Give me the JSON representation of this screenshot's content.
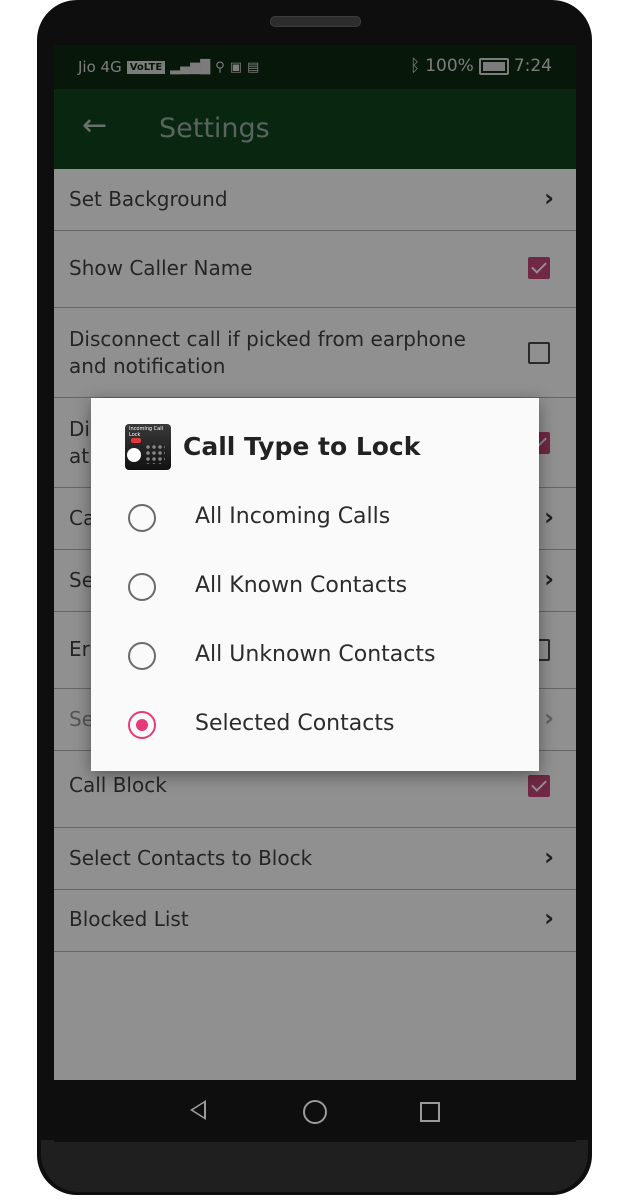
{
  "status_bar": {
    "carrier": "Jio 4G",
    "volte": "VoLTE",
    "battery": "100%",
    "time": "7:24"
  },
  "app_bar": {
    "title": "Settings",
    "back_icon": "back-arrow-icon"
  },
  "settings": [
    {
      "label": "Set Background",
      "control": "chevron"
    },
    {
      "label": "Show Caller Name",
      "control": "checkbox",
      "checked": true
    },
    {
      "label": "Disconnect call if picked from earphone and notification",
      "control": "checkbox",
      "checked": false
    },
    {
      "label": "Di",
      "label2": "at",
      "control": "checkbox",
      "checked": true
    },
    {
      "label": "Ca",
      "control": "chevron"
    },
    {
      "label": "Se",
      "control": "chevron"
    },
    {
      "label": "Er",
      "control": "checkbox",
      "checked": false
    },
    {
      "label": "Se",
      "control": "chevron",
      "disabled": true
    },
    {
      "label": "Call Block",
      "control": "checkbox",
      "checked": true
    },
    {
      "label": "Select Contacts to Block",
      "control": "chevron"
    },
    {
      "label": "Blocked List",
      "control": "chevron"
    }
  ],
  "dialog": {
    "title": "Call Type to Lock",
    "icon_text": "Incoming Call Lock",
    "options": [
      {
        "label": "All Incoming Calls",
        "selected": false
      },
      {
        "label": "All Known Contacts",
        "selected": false
      },
      {
        "label": "All Unknown Contacts",
        "selected": false
      },
      {
        "label": "Selected Contacts",
        "selected": true
      }
    ]
  },
  "colors": {
    "status_bar": "#0c2713",
    "app_bar": "#0f3e1c",
    "accent": "#e8397a",
    "checkbox_checked": "#b7426f"
  }
}
